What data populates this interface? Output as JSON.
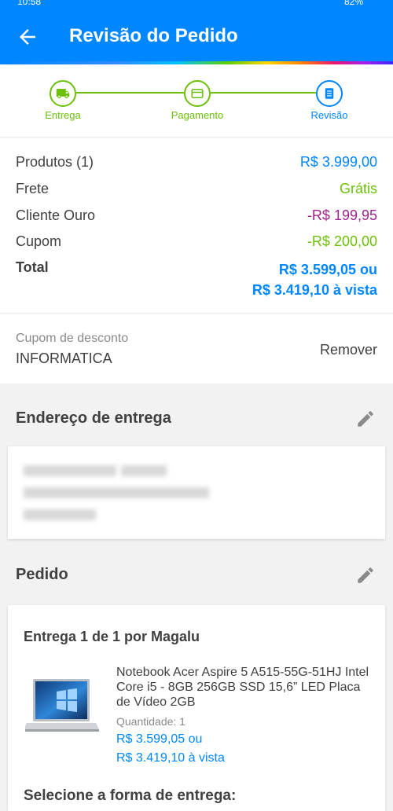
{
  "status_bar": {
    "time": "10:58",
    "battery": "82%"
  },
  "header": {
    "title": "Revisão do Pedido"
  },
  "steps": [
    {
      "label": "Entrega",
      "icon": "truck-icon"
    },
    {
      "label": "Pagamento",
      "icon": "card-icon"
    },
    {
      "label": "Revisão",
      "icon": "document-icon"
    }
  ],
  "summary": {
    "products_label": "Produtos (1)",
    "products_value": "R$ 3.999,00",
    "shipping_label": "Frete",
    "shipping_value": "Grátis",
    "gold_label": "Cliente Ouro",
    "gold_value": "-R$ 199,95",
    "coupon_label": "Cupom",
    "coupon_value": "-R$ 200,00",
    "total_label": "Total",
    "total_value_1": "R$ 3.599,05 ou",
    "total_value_2": "R$ 3.419,10 à vista"
  },
  "coupon": {
    "label": "Cupom de desconto",
    "code": "INFORMATICA",
    "remove": "Remover"
  },
  "address": {
    "title": "Endereço de entrega"
  },
  "order": {
    "title": "Pedido",
    "delivery": "Entrega 1 de 1 por Magalu",
    "product_name": "Notebook Acer Aspire 5 A515-55G-51HJ Intel Core i5 - 8GB 256GB SSD 15,6” LED Placa de Vídeo 2GB",
    "quantity": "Quantidade: 1",
    "price_1": "R$ 3.599,05 ou",
    "price_2": "R$ 3.419,10 à vista",
    "select_shipping": "Selecione a forma de entrega:"
  },
  "colors": {
    "brand": "#0086ff",
    "green": "#6cc00a",
    "purple": "#a0248c"
  }
}
